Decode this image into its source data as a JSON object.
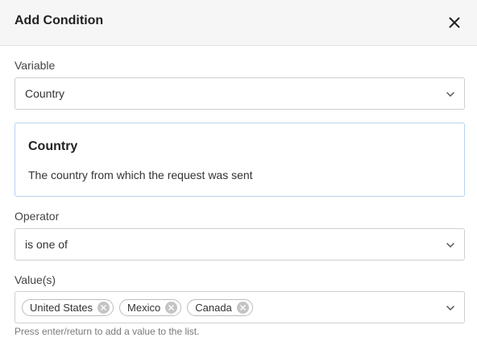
{
  "dialog": {
    "title": "Add Condition",
    "close_icon": "close-icon"
  },
  "variable": {
    "label": "Variable",
    "selected": "Country",
    "icon": "chevron-down-icon"
  },
  "info": {
    "title": "Country",
    "description": "The country from which the request was sent"
  },
  "operator": {
    "label": "Operator",
    "selected": "is one of",
    "icon": "chevron-down-icon"
  },
  "values": {
    "label": "Value(s)",
    "tags": [
      "United States",
      "Mexico",
      "Canada"
    ],
    "tag_remove_icon": "circle-x-icon",
    "icon": "chevron-down-icon",
    "help": "Press enter/return to add a value to the list."
  },
  "colors": {
    "header_bg": "#f6f6f6",
    "info_border": "#b7d2ec",
    "input_border": "#cfcfcf"
  }
}
